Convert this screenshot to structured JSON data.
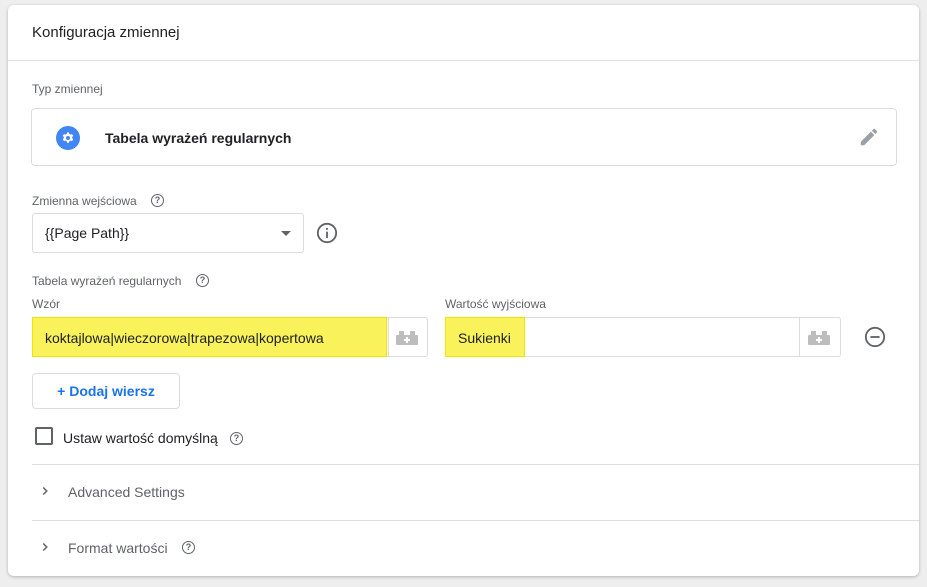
{
  "card": {
    "title": "Konfiguracja zmiennej"
  },
  "variable_type": {
    "section_label": "Typ zmiennej",
    "icon": "gear-icon",
    "value": "Tabela wyrażeń regularnych",
    "edit_icon": "pencil-icon",
    "accent_color": "#4285f4"
  },
  "input_variable": {
    "label": "Zmienna wejściowa",
    "selected": "{{Page Path}}"
  },
  "regex_table": {
    "label": "Tabela wyrażeń regularnych",
    "pattern_header": "Wzór",
    "output_header": "Wartość wyjściowa",
    "rows": [
      {
        "pattern": "koktajlowa|wieczorowa|trapezowa|kopertowa",
        "output": "Sukienki"
      }
    ],
    "add_row_label": "+ Dodaj wiersz",
    "highlight_color": "#f9f25a"
  },
  "default_value": {
    "label": "Ustaw wartość domyślną",
    "checked": false
  },
  "advanced": {
    "label": "Advanced Settings"
  },
  "format": {
    "label": "Format wartości"
  }
}
